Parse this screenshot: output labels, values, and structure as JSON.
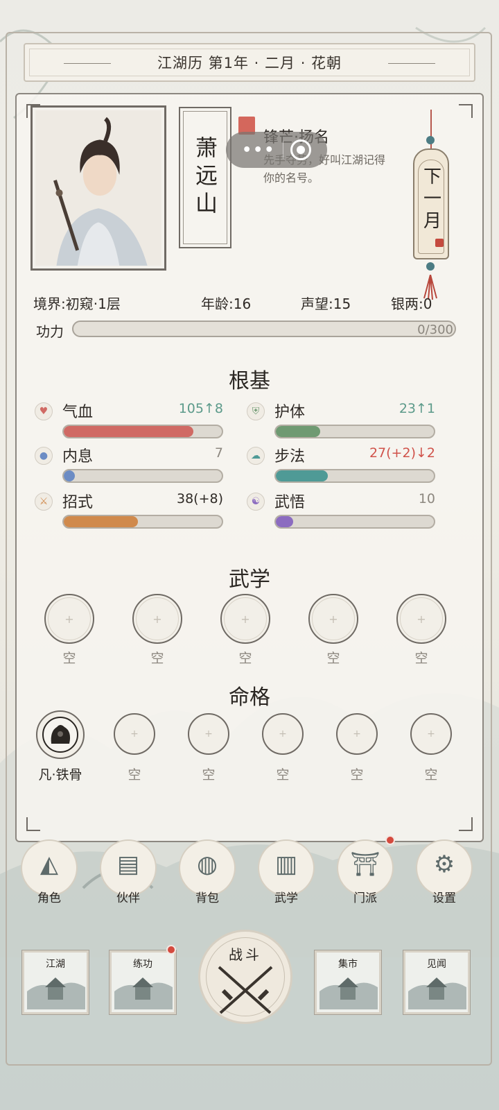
{
  "calendar": {
    "text": "江湖历  第1年 · 二月 · 花朝"
  },
  "character": {
    "name": "萧远山",
    "title": "锋芒·扬名",
    "title_desc": "先手夺势，好叫江湖记得你的名号。",
    "next_month_label": "下一月"
  },
  "stats": {
    "realm": "境界:初窥·1层",
    "age": "年龄:16",
    "reputation": "声望:15",
    "silver": "银两:0"
  },
  "power": {
    "label": "功力",
    "value_text": "0/300",
    "fraction": 0.0
  },
  "foundation": {
    "title": "根基",
    "attributes": [
      {
        "name": "气血",
        "value": "105↑8",
        "value_color": "#5c9a8a",
        "fill": 0.82,
        "color": "#d06a64",
        "icon": "heart-icon"
      },
      {
        "name": "护体",
        "value": "23↑1",
        "value_color": "#5c9a8a",
        "fill": 0.28,
        "color": "#6f9a72",
        "icon": "shield-icon"
      },
      {
        "name": "内息",
        "value": "7",
        "value_color": "#8c877f",
        "fill": 0.07,
        "color": "#6c8cc4",
        "icon": "gourd-icon"
      },
      {
        "name": "步法",
        "value": "27(+2)↓2",
        "value_color": "#d0524a",
        "fill": 0.33,
        "color": "#4f9a96",
        "icon": "cloud-icon"
      },
      {
        "name": "招式",
        "value": "38(+8)",
        "value_color": "#2f2a26",
        "fill": 0.47,
        "color": "#d08a4c",
        "icon": "sword-icon"
      },
      {
        "name": "武悟",
        "value": "10",
        "value_color": "#8c877f",
        "fill": 0.11,
        "color": "#8c6cc0",
        "icon": "yinyang-icon"
      }
    ]
  },
  "martial_arts": {
    "title": "武学",
    "slots": [
      "空",
      "空",
      "空",
      "空",
      "空"
    ]
  },
  "destiny": {
    "title": "命格",
    "filled_label": "凡·铁骨",
    "slots": [
      "空",
      "空",
      "空",
      "空",
      "空"
    ]
  },
  "nav": [
    {
      "label": "角色",
      "icon": "hat-icon",
      "badge": false
    },
    {
      "label": "伙伴",
      "icon": "book-icon",
      "badge": false
    },
    {
      "label": "背包",
      "icon": "pouch-icon",
      "badge": false
    },
    {
      "label": "武学",
      "icon": "scroll-icon",
      "badge": false
    },
    {
      "label": "门派",
      "icon": "gate-icon",
      "badge": true
    },
    {
      "label": "设置",
      "icon": "gear-icon",
      "badge": false
    }
  ],
  "scenes": [
    {
      "label": "江湖",
      "badge": false
    },
    {
      "label": "练功",
      "badge": true
    },
    {
      "label": "集市",
      "badge": false
    },
    {
      "label": "见闻",
      "badge": false
    }
  ],
  "battle": {
    "label": "战斗"
  }
}
